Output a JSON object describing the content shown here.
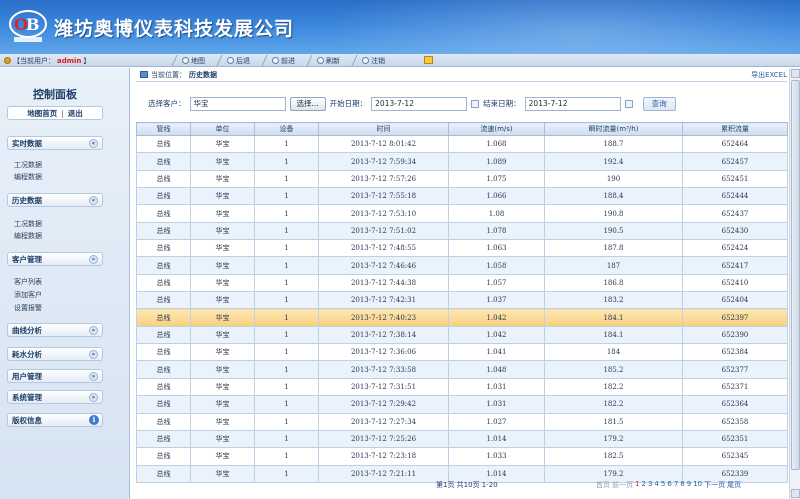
{
  "header": {
    "company": "潍坊奥博仪表科技发展公司"
  },
  "toolbar": {
    "user_label": "【当前用户：",
    "user_name": "admin",
    "user_suffix": "】",
    "nav": [
      "地图",
      "后退",
      "前进",
      "刷新",
      "注销"
    ]
  },
  "sidebar": {
    "title": "控制面板",
    "home": "地图首页",
    "logout": "退出",
    "groups": [
      {
        "label": "实时数据",
        "items": [
          "工况数据",
          "编程数据"
        ]
      },
      {
        "label": "历史数据",
        "items": [
          "工况数据",
          "编程数据"
        ]
      },
      {
        "label": "客户管理",
        "items": [
          "客户列表",
          "添加客户",
          "设置报警"
        ]
      },
      {
        "label": "曲线分析",
        "items": []
      },
      {
        "label": "耗水分析",
        "items": []
      },
      {
        "label": "用户管理",
        "items": []
      },
      {
        "label": "系统管理",
        "items": []
      },
      {
        "label": "版权信息",
        "items": []
      }
    ]
  },
  "main": {
    "breadcrumb_prefix": "当前位置：",
    "breadcrumb_current": "历史数据",
    "export": "导出EXCEL",
    "filters": {
      "customer_label": "选择客户：",
      "customer_value": "华宝",
      "select_button": "选择...",
      "start_label": "开始日期：",
      "start_value": "2013-7-12",
      "end_label": "结束日期：",
      "end_value": "2013-7-12",
      "query_button": "查询"
    },
    "table": {
      "headers": [
        "管线",
        "单位",
        "设备",
        "时间",
        "流速(m/s)",
        "瞬时流量(m³/h)",
        "累积流量"
      ],
      "rows": [
        [
          "总线",
          "华宝",
          "1",
          "2013-7-12 8:01:42",
          "1.068",
          "188.7",
          "652464"
        ],
        [
          "总线",
          "华宝",
          "1",
          "2013-7-12 7:59:34",
          "1.089",
          "192.4",
          "652457"
        ],
        [
          "总线",
          "华宝",
          "1",
          "2013-7-12 7:57:26",
          "1.075",
          "190",
          "652451"
        ],
        [
          "总线",
          "华宝",
          "1",
          "2013-7-12 7:55:18",
          "1.066",
          "188.4",
          "652444"
        ],
        [
          "总线",
          "华宝",
          "1",
          "2013-7-12 7:53:10",
          "1.08",
          "190.8",
          "652437"
        ],
        [
          "总线",
          "华宝",
          "1",
          "2013-7-12 7:51:02",
          "1.078",
          "190.5",
          "652430"
        ],
        [
          "总线",
          "华宝",
          "1",
          "2013-7-12 7:48:55",
          "1.063",
          "187.8",
          "652424"
        ],
        [
          "总线",
          "华宝",
          "1",
          "2013-7-12 7:46:46",
          "1.058",
          "187",
          "652417"
        ],
        [
          "总线",
          "华宝",
          "1",
          "2013-7-12 7:44:38",
          "1.057",
          "186.8",
          "652410"
        ],
        [
          "总线",
          "华宝",
          "1",
          "2013-7-12 7:42:31",
          "1.037",
          "183.2",
          "652404"
        ],
        [
          "总线",
          "华宝",
          "1",
          "2013-7-12 7:40:23",
          "1.042",
          "184.1",
          "652397"
        ],
        [
          "总线",
          "华宝",
          "1",
          "2013-7-12 7:38:14",
          "1.042",
          "184.1",
          "652390"
        ],
        [
          "总线",
          "华宝",
          "1",
          "2013-7-12 7:36:06",
          "1.041",
          "184",
          "652384"
        ],
        [
          "总线",
          "华宝",
          "1",
          "2013-7-12 7:33:58",
          "1.048",
          "185.2",
          "652377"
        ],
        [
          "总线",
          "华宝",
          "1",
          "2013-7-12 7:31:51",
          "1.031",
          "182.2",
          "652371"
        ],
        [
          "总线",
          "华宝",
          "1",
          "2013-7-12 7:29:42",
          "1.031",
          "182.2",
          "652364"
        ],
        [
          "总线",
          "华宝",
          "1",
          "2013-7-12 7:27:34",
          "1.027",
          "181.5",
          "652358"
        ],
        [
          "总线",
          "华宝",
          "1",
          "2013-7-12 7:25:26",
          "1.014",
          "179.2",
          "652351"
        ],
        [
          "总线",
          "华宝",
          "1",
          "2013-7-12 7:23:18",
          "1.033",
          "182.5",
          "652345"
        ],
        [
          "总线",
          "华宝",
          "1",
          "2013-7-12 7:21:11",
          "1.014",
          "179.2",
          "652339"
        ]
      ],
      "selected_row": 10
    },
    "pager": {
      "info": "第1页 共10页 1-20",
      "first": "首页",
      "prev": "前一页",
      "pages": [
        "1",
        "2",
        "3",
        "4",
        "5",
        "6",
        "7",
        "8",
        "9",
        "10"
      ],
      "current": "1",
      "next": "下一页",
      "last": "尾页"
    }
  },
  "colors": {
    "header": "#3b86dc",
    "selected_row": "#f7cf7e",
    "alt_row": "#eaf3fc",
    "current_page": "#d81e1e"
  }
}
